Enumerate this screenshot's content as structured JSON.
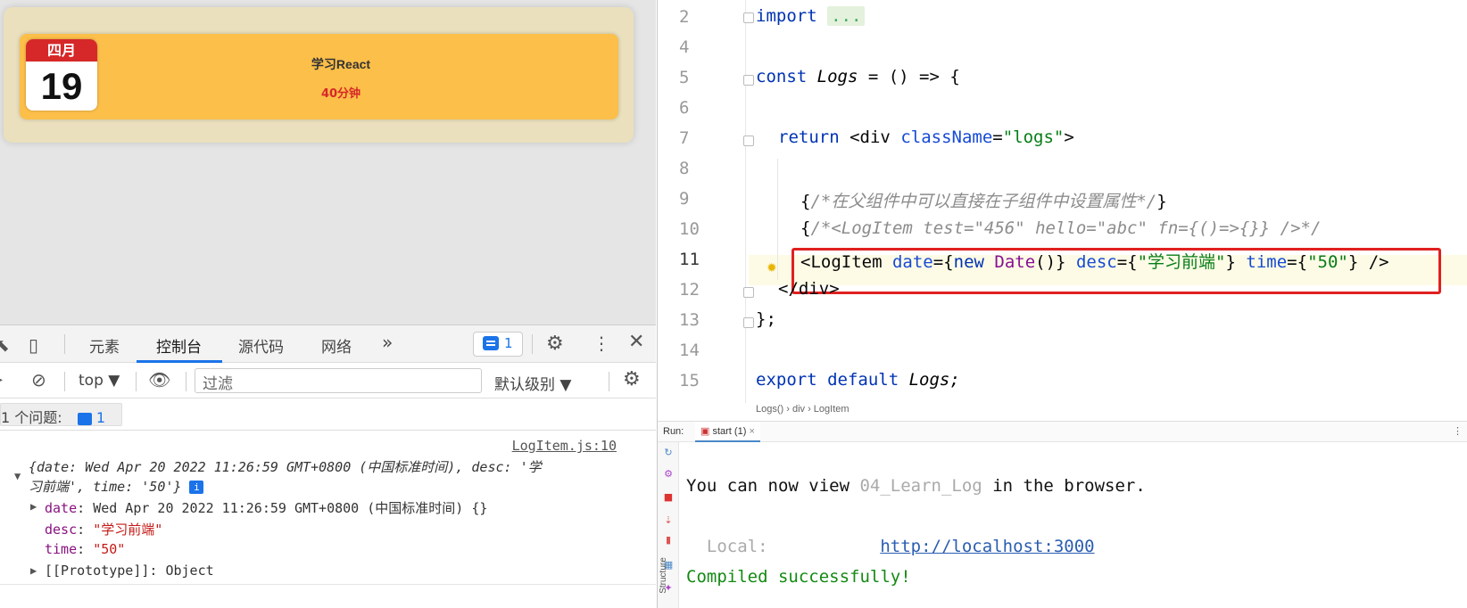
{
  "browser": {
    "log_item": {
      "month": "四月",
      "day": "19",
      "desc": "学习React",
      "time": "40分钟"
    },
    "devtools": {
      "tabs": [
        "元素",
        "控制台",
        "源代码",
        "网络"
      ],
      "active_tab": "控制台",
      "more": "»",
      "badge_count": "1",
      "context": "top ▼",
      "filter_placeholder": "过滤",
      "level": "默认级别 ▼",
      "issues_label": "1 个问题:",
      "issues_count": "1",
      "source_link": "LogItem.js:10",
      "log_summary_1": "{date: Wed Apr 20 2022 11:26:59 GMT+0800 (中国标准时间), desc: '学",
      "log_summary_2": "习前端', time: '50'}",
      "info": "i",
      "props": {
        "date_key": "date",
        "date_val": "Wed Apr 20 2022 11:26:59 GMT+0800 (中国标准时间) {}",
        "desc_key": "desc",
        "desc_val": "\"学习前端\"",
        "time_key": "time",
        "time_val": "\"50\"",
        "proto": "[[Prototype]]: Object"
      }
    }
  },
  "editor": {
    "line_numbers": [
      "2",
      "4",
      "5",
      "6",
      "7",
      "8",
      "9",
      "10",
      "11",
      "12",
      "13",
      "14",
      "15"
    ],
    "current_line": "11",
    "lines": {
      "l2_kw": "import",
      "l2_fold": "...",
      "l5_kw": "const",
      "l5_name": "Logs",
      "l5_rest": " = () => {",
      "l7_kw": "return",
      "l7_tag_open": "<div",
      "l7_attr": "className",
      "l7_eq": "=",
      "l7_str": "\"logs\"",
      "l7_close": ">",
      "l9_open": "{",
      "l9_cmt": "/*在父组件中可以直接在子组件中设置属性*/",
      "l9_close": "}",
      "l10_open": "{",
      "l10_cmt": "/*<LogItem test=\"456\" hello=\"abc\" fn={()=>{}} />*/",
      "l11_tag": "<LogItem",
      "l11_a1": "date",
      "l11_v1a": "={",
      "l11_new": "new",
      "l11_cls": "Date",
      "l11_v1b": "()}",
      "l11_a2": "desc",
      "l11_v2a": "={",
      "l11_s2": "\"学习前端\"",
      "l11_v2b": "}",
      "l11_a3": "time",
      "l11_v3a": "={",
      "l11_s3": "\"50\"",
      "l11_v3b": "}",
      "l11_end": "/>",
      "l12": "</div>",
      "l13": "};",
      "l15_kw": "export default",
      "l15_name": "Logs;"
    },
    "breadcrumb": "Logs()  ›  div  ›  LogItem"
  },
  "run": {
    "label": "Run:",
    "tab": "start (1)",
    "close": "×",
    "structure": "Structure",
    "line1_a": "You can now view ",
    "line1_b": "04_Learn_Log",
    "line1_c": " in the browser.",
    "local_label": "  Local:",
    "local_url": "http://localhost:3000",
    "compiled": "Compiled successfully!"
  }
}
